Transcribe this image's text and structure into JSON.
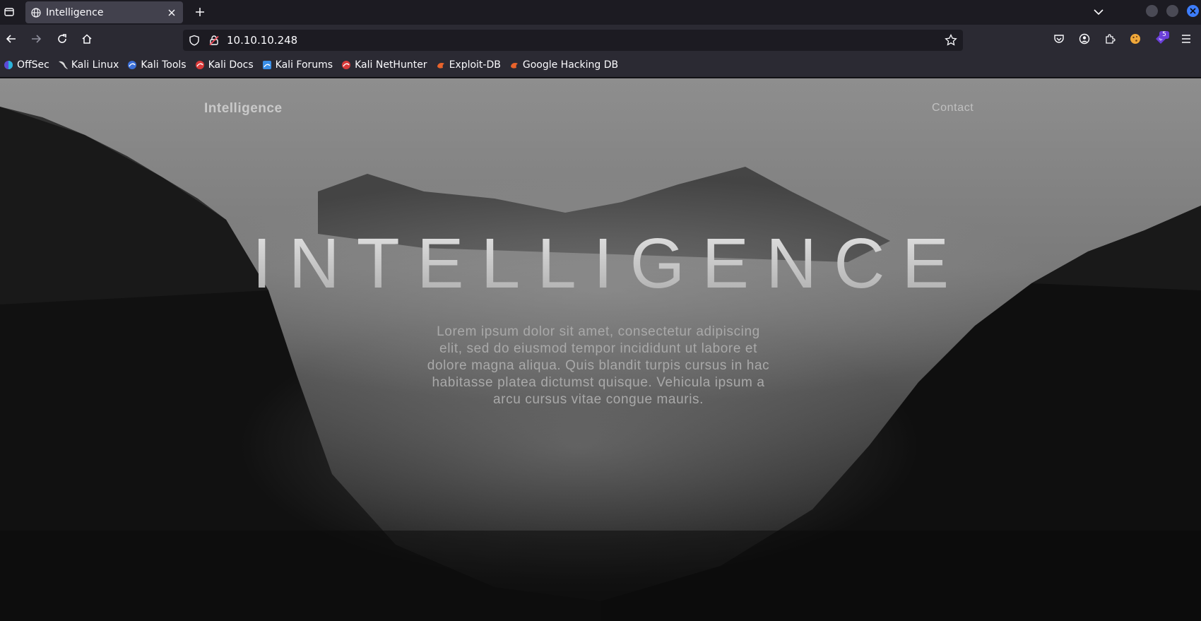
{
  "browser": {
    "tab": {
      "title": "Intelligence"
    },
    "url": "10.10.10.248",
    "extension_badge": "5",
    "bookmarks": [
      {
        "label": "OffSec",
        "icon": "offsec-icon"
      },
      {
        "label": "Kali Linux",
        "icon": "kali-dragon-icon"
      },
      {
        "label": "Kali Tools",
        "icon": "kali-tools-icon"
      },
      {
        "label": "Kali Docs",
        "icon": "kali-docs-icon"
      },
      {
        "label": "Kali Forums",
        "icon": "kali-forums-icon"
      },
      {
        "label": "Kali NetHunter",
        "icon": "kali-nethunter-icon"
      },
      {
        "label": "Exploit-DB",
        "icon": "exploit-db-icon"
      },
      {
        "label": "Google Hacking DB",
        "icon": "ghdb-icon"
      }
    ]
  },
  "site": {
    "brand": "Intelligence",
    "nav_contact": "Contact",
    "hero_title": "INTELLIGENCE",
    "hero_text": "Lorem ipsum dolor sit amet, consectetur adipiscing elit, sed do eiusmod tempor incididunt ut labore et dolore magna aliqua. Quis blandit turpis cursus in hac habitasse platea dictumst quisque. Vehicula ipsum a arcu cursus vitae congue mauris."
  },
  "colors": {
    "tab_active": "#42414d",
    "chrome_bg": "#2b2a33",
    "accent": "#3d7dfc"
  }
}
